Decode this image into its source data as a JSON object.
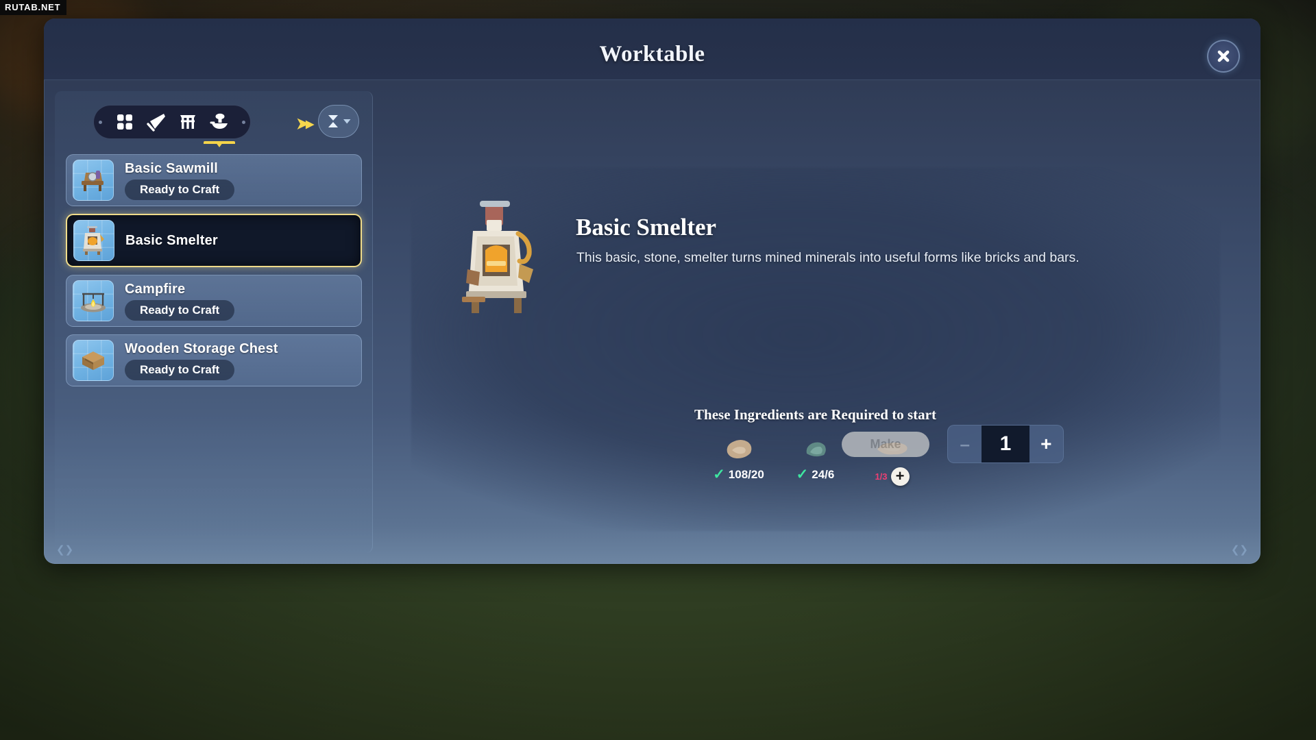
{
  "watermark": "RUTAB.NET",
  "window": {
    "title": "Worktable",
    "close_icon": "close-icon"
  },
  "sidebar": {
    "categories": [
      {
        "id": "all",
        "icon": "grid-squares-icon",
        "active": false
      },
      {
        "id": "tools",
        "icon": "trowel-icon",
        "active": false
      },
      {
        "id": "furniture",
        "icon": "stool-icon",
        "active": false
      },
      {
        "id": "stations",
        "icon": "anvil-icon",
        "active": true
      }
    ],
    "arrow_icon": "chevron-right-icon",
    "sort_button": {
      "icon": "sort-icon",
      "chevron": "chevron-down-icon"
    },
    "recipes": [
      {
        "name": "Basic Sawmill",
        "status": "Ready to Craft",
        "selected": false,
        "icon": "sawmill-icon"
      },
      {
        "name": "Basic Smelter",
        "status": "",
        "selected": true,
        "icon": "smelter-icon"
      },
      {
        "name": "Campfire",
        "status": "Ready to Craft",
        "selected": false,
        "icon": "campfire-icon"
      },
      {
        "name": "Wooden Storage Chest",
        "status": "Ready to Craft",
        "selected": false,
        "icon": "chest-icon"
      }
    ]
  },
  "detail": {
    "title": "Basic Smelter",
    "description": "This basic, stone, smelter turns mined minerals into useful forms like bricks and bars.",
    "ingredients_heading": "These Ingredients are Required to start",
    "ingredients": [
      {
        "icon": "stone-icon",
        "have": 108,
        "need": 20,
        "count_text": "108/20",
        "satisfied": true
      },
      {
        "icon": "clay-icon",
        "have": 24,
        "need": 6,
        "count_text": "24/6",
        "satisfied": true
      },
      {
        "icon": "leather-icon",
        "have": 1,
        "need": 3,
        "count_text": "1/3",
        "satisfied": false,
        "add_label": "+"
      }
    ],
    "make_button": "Make",
    "make_enabled": false,
    "quantity": "1",
    "minus_label": "–",
    "plus_label": "+"
  },
  "colors": {
    "accent_yellow": "#f5d44a",
    "check_green": "#3ee6a0",
    "missing_pink": "#ef3f72",
    "panel_dark": "#2c3750"
  }
}
